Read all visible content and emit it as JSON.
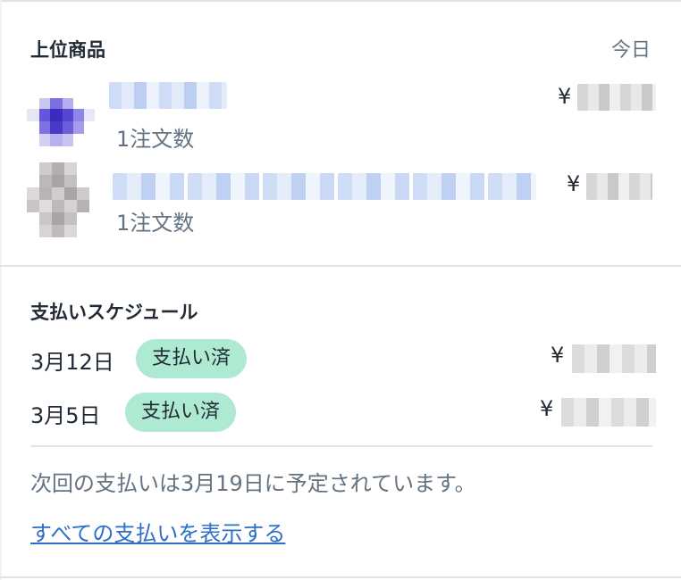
{
  "top_products": {
    "title": "上位商品",
    "period": "今日",
    "items": [
      {
        "orders": "1注文数",
        "currency": "¥",
        "thumb_color": "#5a4bd6"
      },
      {
        "orders": "1注文数",
        "currency": "¥",
        "thumb_color": "#b8b2b4"
      }
    ]
  },
  "payout_schedule": {
    "title": "支払いスケジュール",
    "rows": [
      {
        "date": "3月12日",
        "status": "支払い済",
        "currency": "¥"
      },
      {
        "date": "3月5日",
        "status": "支払い済",
        "currency": "¥"
      }
    ],
    "next_note": "次回の支払いは3月19日に予定されています。",
    "view_all_link": "すべての支払いを表示する"
  },
  "colors": {
    "badge_bg": "#aee9d1",
    "link": "#2c6ecb",
    "muted_text": "#637381"
  }
}
